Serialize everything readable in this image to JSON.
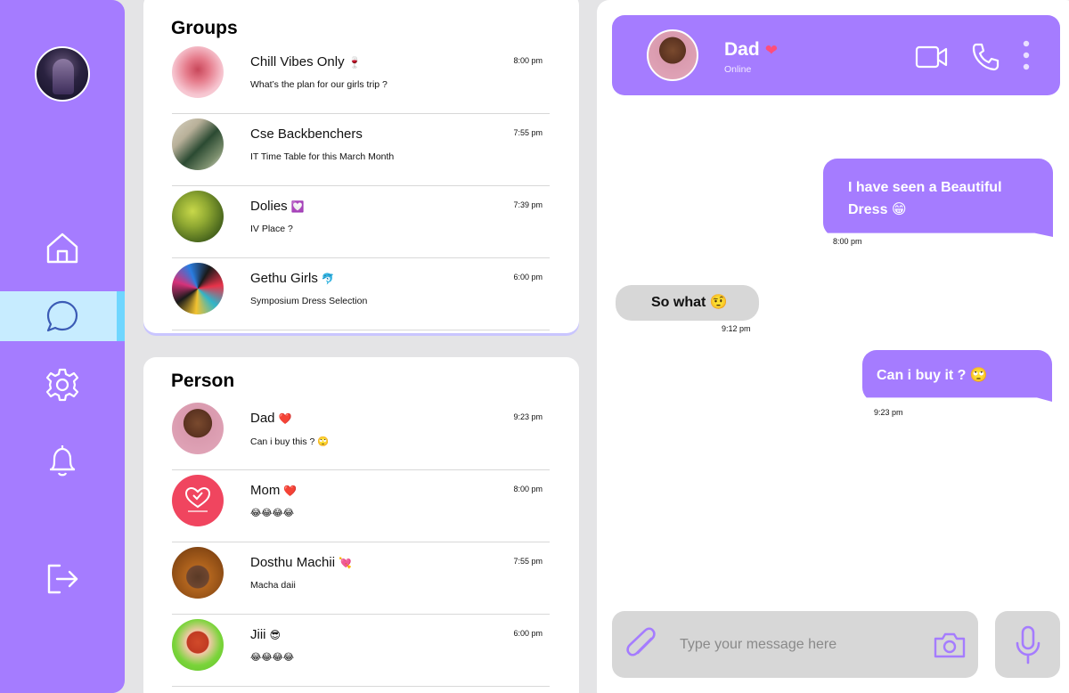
{
  "sidebar": {
    "items": [
      {
        "name": "home",
        "icon": "home-icon"
      },
      {
        "name": "chats",
        "icon": "chat-bubble-icon",
        "active": true
      },
      {
        "name": "settings",
        "icon": "gear-icon"
      },
      {
        "name": "notifications",
        "icon": "bell-icon"
      },
      {
        "name": "logout",
        "icon": "logout-icon"
      }
    ]
  },
  "groups": {
    "title": "Groups",
    "items": [
      {
        "name": "Chill Vibes Only",
        "emoji": "🍷",
        "message": "What’s  the  plan for  our  girls trip ?",
        "time": "8:00 pm"
      },
      {
        "name": "Cse Backbenchers",
        "emoji": "",
        "message": "IT Time Table  for  this March Month",
        "time": "7:55 pm"
      },
      {
        "name": "Dolies",
        "emoji": "💟",
        "message": "IV Place ?",
        "time": "7:39 pm"
      },
      {
        "name": "Gethu  Girls",
        "emoji": "🐬",
        "message": "Symposium  Dress  Selection",
        "time": "6:00 pm"
      }
    ]
  },
  "person": {
    "title": "Person",
    "items": [
      {
        "name": "Dad",
        "emoji": "❤️",
        "message": "Can i buy this ? 🙄",
        "time": "9:23 pm"
      },
      {
        "name": "Mom",
        "emoji": "❤️",
        "message": "😂😂😂😂",
        "time": "8:00 pm"
      },
      {
        "name": "Dosthu  Machii",
        "emoji": "💘",
        "message": "Macha daii",
        "time": "7:55 pm"
      },
      {
        "name": "Jiii",
        "emoji": "😎",
        "message": "😂😂😂😂",
        "time": "6:00 pm"
      }
    ]
  },
  "chat": {
    "contact_name": "Dad",
    "contact_emoji": "❤",
    "status": "Online",
    "messages": [
      {
        "direction": "out",
        "text": "I have seen a Beautiful Dress 😁",
        "time": "8:00 pm"
      },
      {
        "direction": "in",
        "text": "So what  🤨",
        "time": "9:12 pm"
      },
      {
        "direction": "out",
        "text": "Can i buy it ?  🙄",
        "time": "9:23 pm"
      }
    ],
    "composer_placeholder": "Type your message here"
  },
  "colors": {
    "accent": "#a57cff",
    "active_nav": "#c7ecff",
    "active_bar": "#6fd6ff",
    "bubble_in": "#d7d7d7"
  }
}
